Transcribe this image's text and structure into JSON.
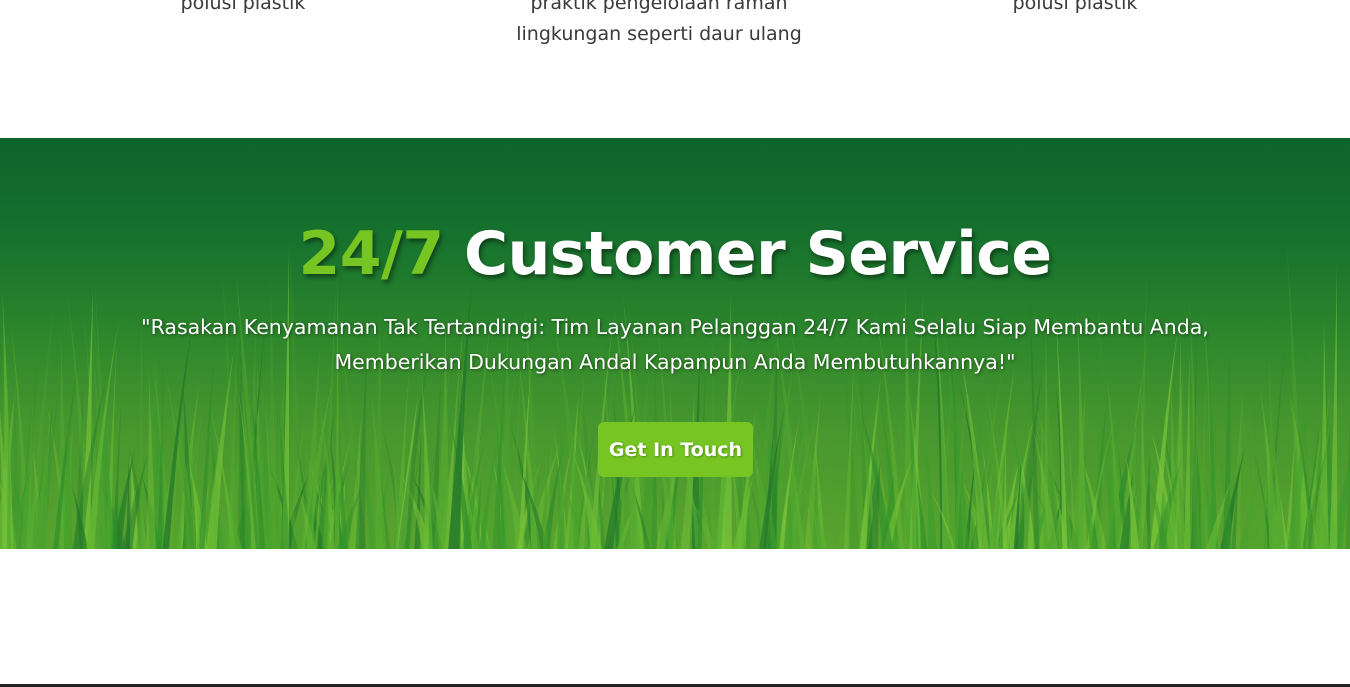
{
  "features": {
    "items": [
      {
        "text": "polusi plastik"
      },
      {
        "text": "praktik pengelolaan ramah lingkungan seperti daur ulang"
      },
      {
        "text": "polusi plastik"
      }
    ]
  },
  "cta": {
    "title_accent": "24/7",
    "title_rest": " Customer Service",
    "subtitle": "\"Rasakan Kenyamanan Tak Tertandingi: Tim Layanan Pelanggan 24/7 Kami Selalu Siap Membantu Anda, Memberikan Dukungan Andal Kapanpun Anda Membutuhkannya!\"",
    "button_label": "Get In Touch",
    "background_image": "green-grass-photo"
  },
  "colors": {
    "accent": "#76c522",
    "banner_dark": "#0f6a2f",
    "banner_light": "#5aa32e",
    "text_dark": "#3a3a3a"
  }
}
